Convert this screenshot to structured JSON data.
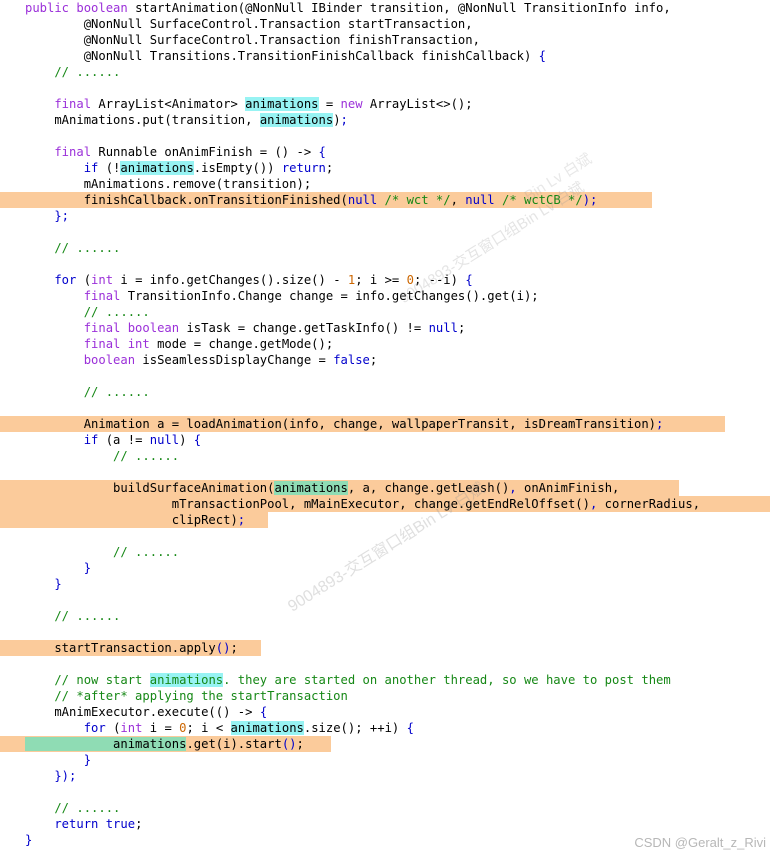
{
  "meta": {
    "language": "Java",
    "background_color": "#ffffff",
    "highlight_band_color": "#fbcb9b",
    "inline_highlight_cyan": "#97f3f3",
    "inline_highlight_green": "#8fdcb4",
    "keyword_color": "#9b30d9",
    "control_color": "#0000cc",
    "comment_color": "#168816",
    "number_color": "#cc6600",
    "plain_color": "#000000"
  },
  "watermarks": {
    "csdn": "CSDN @Geralt_z_Rivi",
    "diagonal_1": "9004893-交互窗口组Bin Lv 白斌",
    "diagonal_2": "9004893-交互窗口组Bin Lv 白斌",
    "diagonal_3": "Bin Lv 白斌"
  },
  "code": {
    "lines": [
      {
        "n": 1,
        "indent": 0,
        "band": null,
        "text": "public boolean startAnimation(@NonNull IBinder transition, @NonNull TransitionInfo info,"
      },
      {
        "n": 2,
        "indent": 0,
        "band": null,
        "text": "        @NonNull SurfaceControl.Transaction startTransaction,"
      },
      {
        "n": 3,
        "indent": 0,
        "band": null,
        "text": "        @NonNull SurfaceControl.Transaction finishTransaction,"
      },
      {
        "n": 4,
        "indent": 0,
        "band": null,
        "text": "        @NonNull Transitions.TransitionFinishCallback finishCallback) {"
      },
      {
        "n": 5,
        "indent": 0,
        "band": null,
        "text": "    // ......"
      },
      {
        "n": 6,
        "indent": 0,
        "band": null,
        "text": ""
      },
      {
        "n": 7,
        "indent": 0,
        "band": null,
        "text": "    final ArrayList<Animator> animations = new ArrayList<>();"
      },
      {
        "n": 8,
        "indent": 0,
        "band": null,
        "text": "    mAnimations.put(transition, animations);"
      },
      {
        "n": 9,
        "indent": 0,
        "band": null,
        "text": ""
      },
      {
        "n": 10,
        "indent": 0,
        "band": null,
        "text": "    final Runnable onAnimFinish = () -> {"
      },
      {
        "n": 11,
        "indent": 0,
        "band": null,
        "text": "        if (!animations.isEmpty()) return;"
      },
      {
        "n": 12,
        "indent": 0,
        "band": null,
        "text": "        mAnimations.remove(transition);"
      },
      {
        "n": 13,
        "indent": 0,
        "band": "652",
        "text": "        finishCallback.onTransitionFinished(null /* wct */, null /* wctCB */);"
      },
      {
        "n": 14,
        "indent": 0,
        "band": null,
        "text": "    };"
      },
      {
        "n": 15,
        "indent": 0,
        "band": null,
        "text": ""
      },
      {
        "n": 16,
        "indent": 0,
        "band": null,
        "text": "    // ......"
      },
      {
        "n": 17,
        "indent": 0,
        "band": null,
        "text": ""
      },
      {
        "n": 18,
        "indent": 0,
        "band": null,
        "text": "    for (int i = info.getChanges().size() - 1; i >= 0; --i) {"
      },
      {
        "n": 19,
        "indent": 0,
        "band": null,
        "text": "        final TransitionInfo.Change change = info.getChanges().get(i);"
      },
      {
        "n": 20,
        "indent": 0,
        "band": null,
        "text": "        // ......"
      },
      {
        "n": 21,
        "indent": 0,
        "band": null,
        "text": "        final boolean isTask = change.getTaskInfo() != null;"
      },
      {
        "n": 22,
        "indent": 0,
        "band": null,
        "text": "        final int mode = change.getMode();"
      },
      {
        "n": 23,
        "indent": 0,
        "band": null,
        "text": "        boolean isSeamlessDisplayChange = false;"
      },
      {
        "n": 24,
        "indent": 0,
        "band": null,
        "text": ""
      },
      {
        "n": 25,
        "indent": 0,
        "band": null,
        "text": "        // ......"
      },
      {
        "n": 26,
        "indent": 0,
        "band": null,
        "text": ""
      },
      {
        "n": 27,
        "indent": 0,
        "band": "725",
        "text": "        Animation a = loadAnimation(info, change, wallpaperTransit, isDreamTransition);"
      },
      {
        "n": 28,
        "indent": 0,
        "band": null,
        "text": "        if (a != null) {"
      },
      {
        "n": 29,
        "indent": 0,
        "band": null,
        "text": "            // ......"
      },
      {
        "n": 30,
        "indent": 0,
        "band": null,
        "text": ""
      },
      {
        "n": 31,
        "indent": 0,
        "band": "679",
        "text": "            buildSurfaceAnimation(animations, a, change.getLeash(), onAnimFinish,"
      },
      {
        "n": 32,
        "indent": 0,
        "band": "770",
        "text": "                    mTransactionPool, mMainExecutor, change.getEndRelOffset(), cornerRadius,"
      },
      {
        "n": 33,
        "indent": 0,
        "band": "268",
        "text": "                    clipRect);"
      },
      {
        "n": 34,
        "indent": 0,
        "band": null,
        "text": ""
      },
      {
        "n": 35,
        "indent": 0,
        "band": null,
        "text": "            // ......"
      },
      {
        "n": 36,
        "indent": 0,
        "band": null,
        "text": "        }"
      },
      {
        "n": 37,
        "indent": 0,
        "band": null,
        "text": "    }"
      },
      {
        "n": 38,
        "indent": 0,
        "band": null,
        "text": ""
      },
      {
        "n": 39,
        "indent": 0,
        "band": null,
        "text": "    // ......"
      },
      {
        "n": 40,
        "indent": 0,
        "band": null,
        "text": ""
      },
      {
        "n": 41,
        "indent": 0,
        "band": "261",
        "text": "    startTransaction.apply();"
      },
      {
        "n": 42,
        "indent": 0,
        "band": null,
        "text": ""
      },
      {
        "n": 43,
        "indent": 0,
        "band": null,
        "text": "    // now start animations. they are started on another thread, so we have to post them"
      },
      {
        "n": 44,
        "indent": 0,
        "band": null,
        "text": "    // *after* applying the startTransaction"
      },
      {
        "n": 45,
        "indent": 0,
        "band": null,
        "text": "    mAnimExecutor.execute(() -> {"
      },
      {
        "n": 46,
        "indent": 0,
        "band": null,
        "text": "        for (int i = 0; i < animations.size(); ++i) {"
      },
      {
        "n": 47,
        "indent": 0,
        "band": "331",
        "text": "            animations.get(i).start();"
      },
      {
        "n": 48,
        "indent": 0,
        "band": null,
        "text": "        }"
      },
      {
        "n": 49,
        "indent": 0,
        "band": null,
        "text": "    });"
      },
      {
        "n": 50,
        "indent": 0,
        "band": null,
        "text": ""
      },
      {
        "n": 51,
        "indent": 0,
        "band": null,
        "text": "    // ......"
      },
      {
        "n": 52,
        "indent": 0,
        "band": null,
        "text": "    return true;"
      },
      {
        "n": 53,
        "indent": 0,
        "band": null,
        "text": "}"
      }
    ],
    "highlighted_symbol": "animations",
    "highlighted_occurrences": [
      7,
      8,
      11,
      31,
      43,
      46,
      47
    ]
  }
}
